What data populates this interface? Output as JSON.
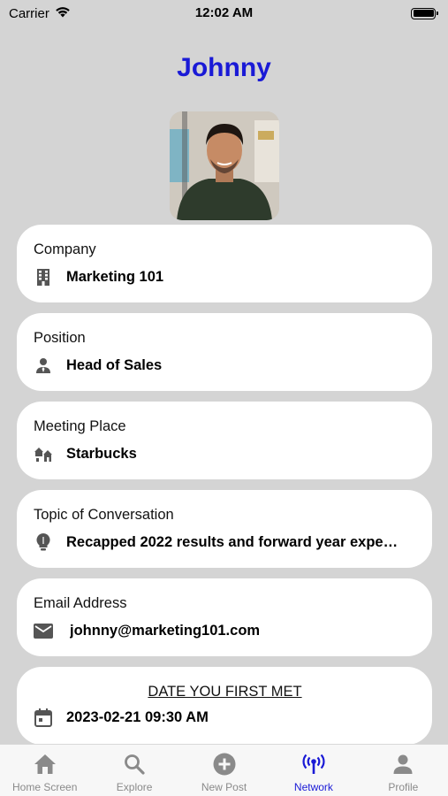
{
  "status_bar": {
    "carrier": "Carrier",
    "time": "12:02 AM"
  },
  "title": "Johnny",
  "cards": [
    {
      "label": "Company",
      "value": "Marketing 101",
      "icon": "building-icon"
    },
    {
      "label": "Position",
      "value": "Head of Sales",
      "icon": "person-tie-icon"
    },
    {
      "label": "Meeting Place",
      "value": "Starbucks",
      "icon": "houses-icon"
    },
    {
      "label": "Topic of Conversation",
      "value": "Recapped 2022 results and forward year expe…",
      "icon": "lightbulb-icon"
    },
    {
      "label": "Email Address",
      "value": "johnny@marketing101.com",
      "icon": "mail-icon"
    }
  ],
  "date_card": {
    "label": "DATE YOU FIRST MET",
    "value": "2023-02-21 09:30 AM",
    "icon": "calendar-icon"
  },
  "tabs": [
    {
      "label": "Home Screen",
      "icon": "home-icon"
    },
    {
      "label": "Explore",
      "icon": "search-icon"
    },
    {
      "label": "New Post",
      "icon": "plus-circle-icon"
    },
    {
      "label": "Network",
      "icon": "antenna-icon",
      "active": true
    },
    {
      "label": "Profile",
      "icon": "person-icon"
    }
  ],
  "colors": {
    "accent": "#1a1ad6",
    "background": "#d4d4d4",
    "tab_inactive": "#8a8a8a"
  }
}
